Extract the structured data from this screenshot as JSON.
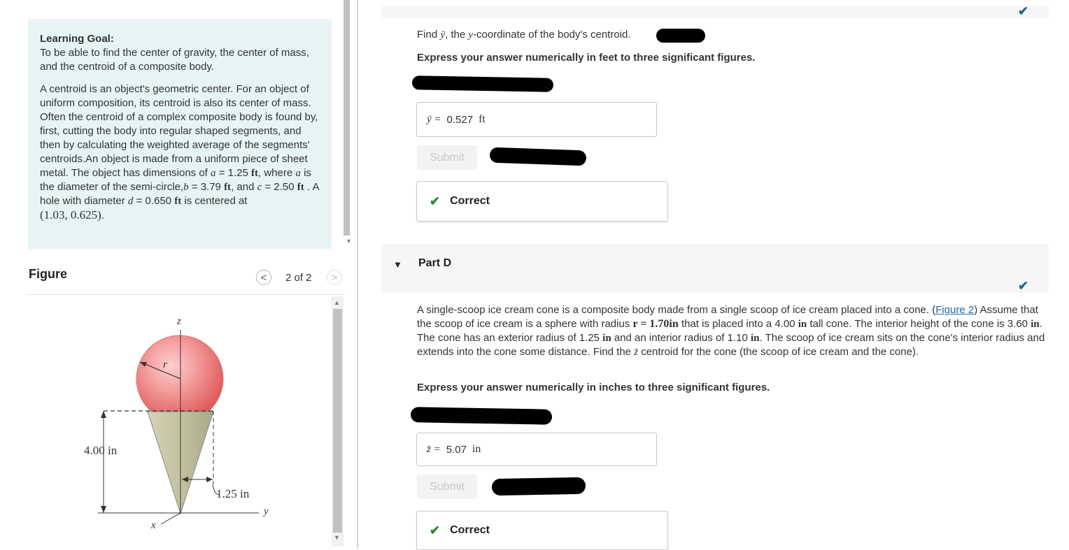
{
  "left_panel": {
    "learning_goal_heading": "Learning Goal:",
    "learning_goal_text": "To be able to find the center of gravity, the center of mass, and the centroid of a composite body.",
    "intro_text": "A centroid is an object's geometric center. For an object of uniform composition, its centroid is also its center of mass. Often the centroid of a complex composite body is found by, first, cutting the body into regular shaped segments, and then by calculating the weighted average of the segments' centroids.An object is made from a uniform piece of sheet metal. The object has dimensions of",
    "var_a": "a",
    "val_a": "1.25",
    "text_a_suffix": ", where",
    "text_a_desc": "is the diameter of the semi-circle,",
    "var_b": "b",
    "val_b": "3.79",
    "text_and": ", and",
    "var_c": "c",
    "val_c": "2.50",
    "text_hole": ". A hole with diameter",
    "var_d": "d",
    "val_d": "0.650",
    "text_centered": "is centered at",
    "center_point": "(1.03, 0.625)",
    "unit_ft": "ft",
    "equals": "="
  },
  "figure": {
    "label": "Figure",
    "prev_icon": "chevron-left-icon",
    "next_icon": "chevron-right-icon",
    "pager_text": "2 of 2",
    "prev_glyph": "<",
    "next_glyph": ">",
    "axis_z": "z",
    "axis_y": "y",
    "axis_x": "x",
    "radius_label": "r",
    "height_label": "4.00 in",
    "radius_dim_label": "1.25 in",
    "colors": {
      "scoop": "#f28a8a",
      "cone": "#c9c9a8"
    }
  },
  "part_c": {
    "question_prefix": "Find",
    "question_var": "ȳ",
    "question_mid": ", the",
    "question_coord": "y",
    "question_suffix": "-coordinate of the body's centroid.",
    "instruction": "Express your answer numerically in feet to three significant figures.",
    "answer_label": "ȳ =",
    "answer_value": "0.527",
    "answer_unit": "ft",
    "submit_label": "Submit",
    "feedback": "Correct",
    "check_icon": "checkmark-icon",
    "check_glyph": "✔"
  },
  "part_d": {
    "toggle_glyph": "▼",
    "title": "Part D",
    "q1": "A single-scoop ice cream cone is a composite body made from a single scoop of ice cream placed into a cone. (",
    "figure_link": "Figure 2",
    "q2": ") Assume that the scoop of ice cream is a sphere with radius",
    "r_expr": "r = 1.70in",
    "q3": "that is placed into a 4.00",
    "unit_in": "in",
    "q4": "tall cone. The interior height of the cone is 3.60",
    "q5": ". The cone has an exterior radius of 1.25",
    "q6": "and an interior radius of 1.10",
    "q7": ". The scoop of ice cream sits on the cone's interior radius and extends into the cone some distance. Find the",
    "z_bar": "z̄",
    "q8": "centroid for the cone (the scoop of ice cream and the cone).",
    "instruction": "Express your answer numerically in inches to three significant figures.",
    "answer_label": "z̄ =",
    "answer_value": "5.07",
    "answer_unit": "in",
    "submit_label": "Submit",
    "feedback": "Correct",
    "check_glyph": "✔"
  },
  "scroll_glyphs": {
    "up": "▲",
    "down": "▼"
  }
}
